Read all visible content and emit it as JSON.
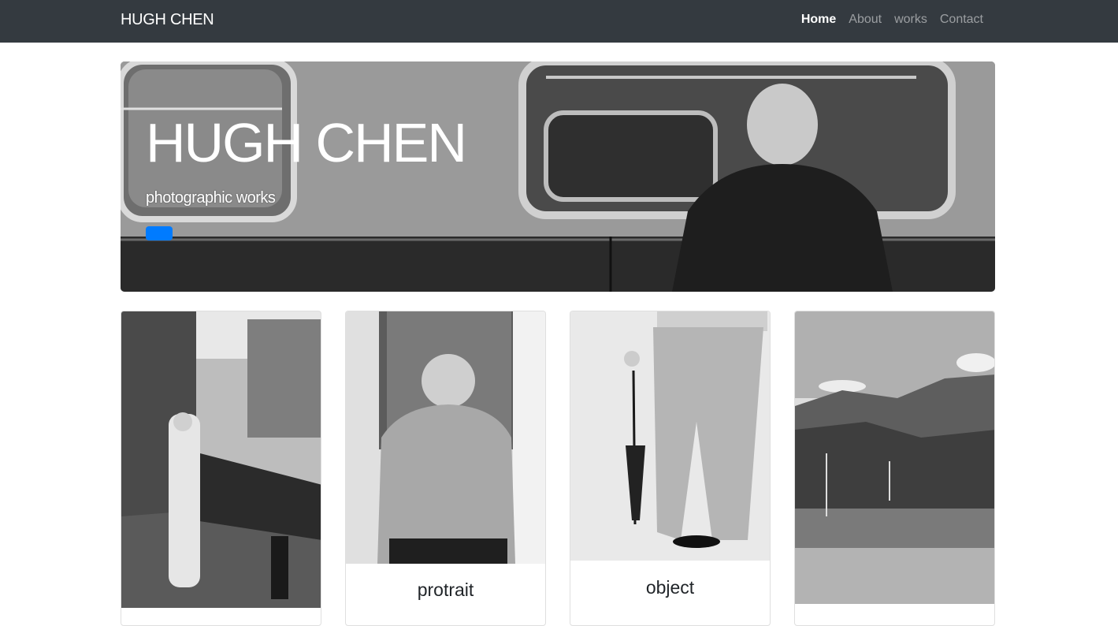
{
  "navbar": {
    "brand": "HUGH CHEN",
    "links": [
      {
        "label": "Home",
        "active": true
      },
      {
        "label": "About",
        "active": false
      },
      {
        "label": "works",
        "active": false
      },
      {
        "label": "Contact",
        "active": false
      }
    ]
  },
  "hero": {
    "title": "HUGH CHEN",
    "subtitle": "photographic works",
    "button_label": ""
  },
  "cards": [
    {
      "title": ""
    },
    {
      "title": "protrait"
    },
    {
      "title": "object"
    },
    {
      "title": ""
    }
  ],
  "colors": {
    "navbar_bg": "#343a40",
    "accent": "#007bff"
  }
}
